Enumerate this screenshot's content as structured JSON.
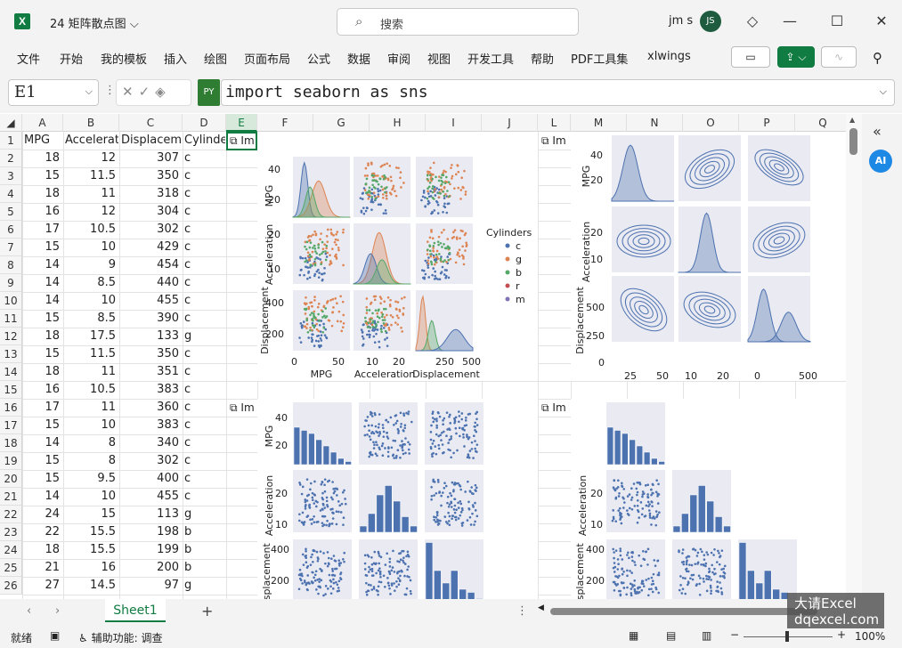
{
  "window": {
    "title": "24 矩阵散点图",
    "user": "jm s",
    "avatar": "JS",
    "search_placeholder": "搜索"
  },
  "menu": [
    "文件",
    "开始",
    "我的模板",
    "插入",
    "绘图",
    "页面布局",
    "公式",
    "数据",
    "审阅",
    "视图",
    "开发工具",
    "帮助",
    "PDF工具集",
    "xlwings"
  ],
  "formula": {
    "cell_ref": "E1",
    "py_badge": "PY",
    "content": "import seaborn as sns"
  },
  "columns": [
    "A",
    "B",
    "C",
    "D",
    "E",
    "F",
    "G",
    "H",
    "I",
    "J",
    "L",
    "M",
    "N",
    "O",
    "P",
    "Q"
  ],
  "rows": [
    "1",
    "2",
    "3",
    "4",
    "5",
    "6",
    "7",
    "8",
    "9",
    "10",
    "11",
    "12",
    "13",
    "14",
    "15",
    "16",
    "17",
    "18",
    "19",
    "20",
    "21",
    "22",
    "23",
    "24",
    "25",
    "26"
  ],
  "headers": [
    "MPG",
    "Accelerati",
    "Displaceme",
    "Cylinde"
  ],
  "table": [
    [
      "18",
      "12",
      "307",
      "c"
    ],
    [
      "15",
      "11.5",
      "350",
      "c"
    ],
    [
      "18",
      "11",
      "318",
      "c"
    ],
    [
      "16",
      "12",
      "304",
      "c"
    ],
    [
      "17",
      "10.5",
      "302",
      "c"
    ],
    [
      "15",
      "10",
      "429",
      "c"
    ],
    [
      "14",
      "9",
      "454",
      "c"
    ],
    [
      "14",
      "8.5",
      "440",
      "c"
    ],
    [
      "14",
      "10",
      "455",
      "c"
    ],
    [
      "15",
      "8.5",
      "390",
      "c"
    ],
    [
      "18",
      "17.5",
      "133",
      "g"
    ],
    [
      "15",
      "11.5",
      "350",
      "c"
    ],
    [
      "18",
      "11",
      "351",
      "c"
    ],
    [
      "16",
      "10.5",
      "383",
      "c"
    ],
    [
      "17",
      "11",
      "360",
      "c"
    ],
    [
      "15",
      "10",
      "383",
      "c"
    ],
    [
      "14",
      "8",
      "340",
      "c"
    ],
    [
      "15",
      "8",
      "302",
      "c"
    ],
    [
      "15",
      "9.5",
      "400",
      "c"
    ],
    [
      "14",
      "10",
      "455",
      "c"
    ],
    [
      "24",
      "15",
      "113",
      "g"
    ],
    [
      "22",
      "15.5",
      "198",
      "b"
    ],
    [
      "18",
      "15.5",
      "199",
      "b"
    ],
    [
      "21",
      "16",
      "200",
      "b"
    ],
    [
      "27",
      "14.5",
      "97",
      "g"
    ]
  ],
  "image_labels": [
    "Im",
    "Im",
    "Im",
    "Im"
  ],
  "plot_axes": {
    "vars": [
      "MPG",
      "Acceleration",
      "Displacement"
    ],
    "mpg_ticks": [
      "40",
      "20"
    ],
    "acc_ticks": [
      "20",
      "10"
    ],
    "disp_ticks": [
      "400",
      "200"
    ],
    "x_mpg": [
      "0",
      "50"
    ],
    "x_acc": [
      "10",
      "20"
    ],
    "x_disp": [
      "250",
      "500"
    ],
    "kde_mpg_ticks": [
      "40",
      "20"
    ],
    "kde_acc_ticks": [
      "20",
      "10"
    ],
    "kde_disp_ticks": [
      "500",
      "250",
      "0"
    ],
    "kde_x_mpg": [
      "25",
      "50"
    ],
    "kde_x_acc": [
      "10",
      "20"
    ],
    "kde_x_disp": [
      "0",
      "500"
    ]
  },
  "legend": {
    "title": "Cylinders",
    "items": [
      {
        "label": "c",
        "color": "#4c72b0"
      },
      {
        "label": "g",
        "color": "#dd8452"
      },
      {
        "label": "b",
        "color": "#55a868"
      },
      {
        "label": "r",
        "color": "#c44e52"
      },
      {
        "label": "m",
        "color": "#8172b3"
      }
    ]
  },
  "colors": {
    "accent": "#107c41",
    "pair_blue": "#4c72b0",
    "panel_bg": "#eaeaf2"
  },
  "tabs": {
    "sheet": "Sheet1"
  },
  "status": {
    "ready": "就绪",
    "accessibility": "辅助功能: 调查",
    "zoom": "100%"
  },
  "watermark": {
    "line1": "大请Excel",
    "line2": "dqexcel.com"
  }
}
